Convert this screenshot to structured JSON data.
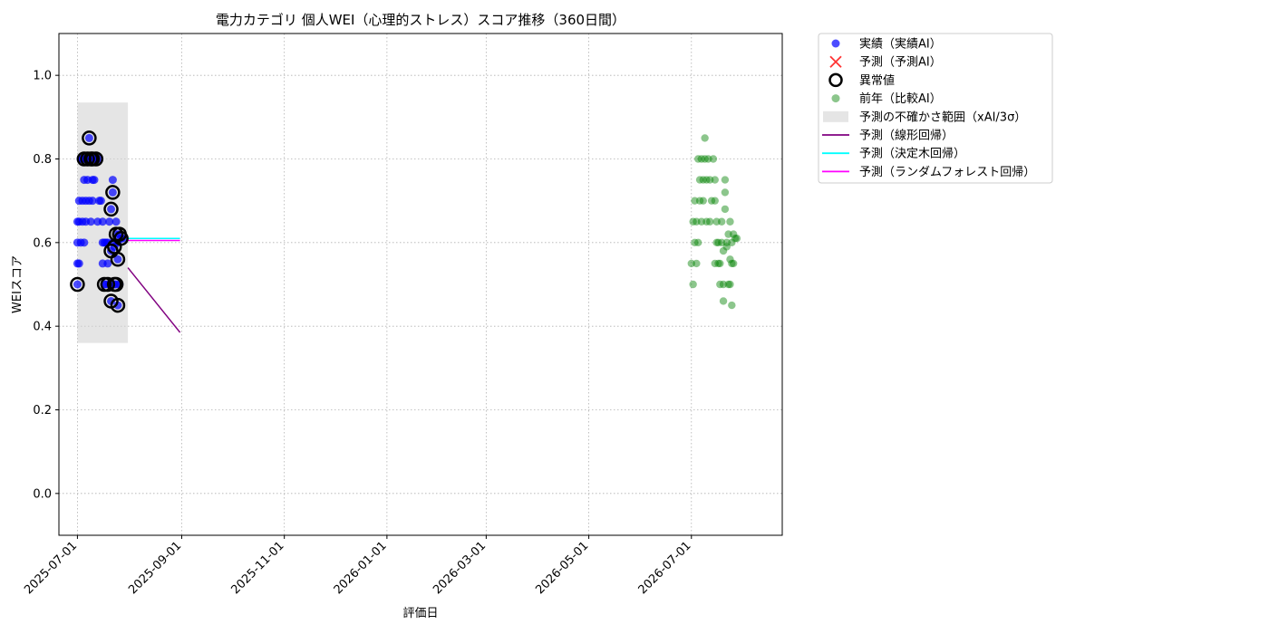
{
  "chart_data": {
    "type": "scatter",
    "title": "電力カテゴリ 個人WEI（心理的ストレス）スコア推移（360日間）",
    "xlabel": "評価日",
    "ylabel": "WEIスコア",
    "xlim": [
      "2025-06-20",
      "2026-08-24"
    ],
    "ylim": [
      -0.1,
      1.1
    ],
    "x_ticks": [
      "2025-07-01",
      "2025-09-01",
      "2025-11-01",
      "2026-01-01",
      "2026-03-01",
      "2026-05-01",
      "2026-07-01"
    ],
    "y_ticks": [
      0.0,
      0.2,
      0.4,
      0.6,
      0.8,
      1.0
    ],
    "y_tick_labels": [
      "0.0",
      "0.2",
      "0.4",
      "0.6",
      "0.8",
      "1.0"
    ],
    "grid": true,
    "legend_position": "outside-right-top",
    "colors": {
      "actual": "#0000ff",
      "predicted": "#ff0000",
      "anomaly": "#000000",
      "previous_year": "#008000",
      "uncertainty_band": "#d3d3d3",
      "linear": "#800080",
      "decision_tree": "#00ffff",
      "random_forest": "#ff00ff"
    },
    "series": [
      {
        "name": "実績（実績AI）",
        "kind": "scatter",
        "points": [
          [
            "2025-07-01",
            0.55
          ],
          [
            "2025-07-01",
            0.6
          ],
          [
            "2025-07-01",
            0.65
          ],
          [
            "2025-07-01",
            0.5
          ],
          [
            "2025-07-02",
            0.7
          ],
          [
            "2025-07-02",
            0.65
          ],
          [
            "2025-07-02",
            0.55
          ],
          [
            "2025-07-03",
            0.6
          ],
          [
            "2025-07-03",
            0.8
          ],
          [
            "2025-07-04",
            0.7
          ],
          [
            "2025-07-04",
            0.65
          ],
          [
            "2025-07-04",
            0.8
          ],
          [
            "2025-07-05",
            0.6
          ],
          [
            "2025-07-05",
            0.75
          ],
          [
            "2025-07-05",
            0.8
          ],
          [
            "2025-07-06",
            0.65
          ],
          [
            "2025-07-06",
            0.7
          ],
          [
            "2025-07-07",
            0.8
          ],
          [
            "2025-07-07",
            0.75
          ],
          [
            "2025-07-08",
            0.85
          ],
          [
            "2025-07-08",
            0.7
          ],
          [
            "2025-07-09",
            0.65
          ],
          [
            "2025-07-09",
            0.8
          ],
          [
            "2025-07-10",
            0.75
          ],
          [
            "2025-07-10",
            0.7
          ],
          [
            "2025-07-11",
            0.8
          ],
          [
            "2025-07-11",
            0.75
          ],
          [
            "2025-07-12",
            0.8
          ],
          [
            "2025-07-13",
            0.65
          ],
          [
            "2025-07-14",
            0.7
          ],
          [
            "2025-07-14",
            0.8
          ],
          [
            "2025-07-15",
            0.7
          ],
          [
            "2025-07-16",
            0.6
          ],
          [
            "2025-07-16",
            0.55
          ],
          [
            "2025-07-16",
            0.65
          ],
          [
            "2025-07-17",
            0.6
          ],
          [
            "2025-07-17",
            0.5
          ],
          [
            "2025-07-18",
            0.6
          ],
          [
            "2025-07-18",
            0.5
          ],
          [
            "2025-07-19",
            0.55
          ],
          [
            "2025-07-19",
            0.6
          ],
          [
            "2025-07-20",
            0.65
          ],
          [
            "2025-07-20",
            0.5
          ],
          [
            "2025-07-21",
            0.46
          ],
          [
            "2025-07-21",
            0.68
          ],
          [
            "2025-07-21",
            0.58
          ],
          [
            "2025-07-22",
            0.72
          ],
          [
            "2025-07-22",
            0.75
          ],
          [
            "2025-07-22",
            0.6
          ],
          [
            "2025-07-23",
            0.59
          ],
          [
            "2025-07-23",
            0.5
          ],
          [
            "2025-07-24",
            0.62
          ],
          [
            "2025-07-24",
            0.65
          ],
          [
            "2025-07-24",
            0.5
          ],
          [
            "2025-07-25",
            0.56
          ],
          [
            "2025-07-25",
            0.45
          ],
          [
            "2025-07-25",
            0.6
          ],
          [
            "2025-07-26",
            0.62
          ],
          [
            "2025-07-26",
            0.5
          ],
          [
            "2025-07-27",
            0.61
          ],
          [
            "2025-07-28",
            0.61
          ]
        ]
      },
      {
        "name": "異常値",
        "kind": "anomaly",
        "points": [
          [
            "2025-07-01",
            0.5
          ],
          [
            "2025-07-05",
            0.8
          ],
          [
            "2025-07-07",
            0.8
          ],
          [
            "2025-07-08",
            0.85
          ],
          [
            "2025-07-09",
            0.8
          ],
          [
            "2025-07-10",
            0.8
          ],
          [
            "2025-07-12",
            0.8
          ],
          [
            "2025-07-17",
            0.5
          ],
          [
            "2025-07-19",
            0.5
          ],
          [
            "2025-07-21",
            0.46
          ],
          [
            "2025-07-21",
            0.68
          ],
          [
            "2025-07-21",
            0.58
          ],
          [
            "2025-07-22",
            0.72
          ],
          [
            "2025-07-23",
            0.59
          ],
          [
            "2025-07-23",
            0.5
          ],
          [
            "2025-07-24",
            0.62
          ],
          [
            "2025-07-24",
            0.5
          ],
          [
            "2025-07-25",
            0.56
          ],
          [
            "2025-07-25",
            0.45
          ],
          [
            "2025-07-26",
            0.62
          ],
          [
            "2025-07-27",
            0.61
          ]
        ]
      },
      {
        "name": "前年（比較AI）",
        "kind": "scatter",
        "points": [
          [
            "2026-07-01",
            0.55
          ],
          [
            "2026-07-02",
            0.5
          ],
          [
            "2026-07-02",
            0.65
          ],
          [
            "2026-07-03",
            0.6
          ],
          [
            "2026-07-03",
            0.7
          ],
          [
            "2026-07-04",
            0.55
          ],
          [
            "2026-07-04",
            0.65
          ],
          [
            "2026-07-05",
            0.6
          ],
          [
            "2026-07-05",
            0.8
          ],
          [
            "2026-07-06",
            0.7
          ],
          [
            "2026-07-06",
            0.75
          ],
          [
            "2026-07-07",
            0.65
          ],
          [
            "2026-07-07",
            0.8
          ],
          [
            "2026-07-08",
            0.75
          ],
          [
            "2026-07-08",
            0.7
          ],
          [
            "2026-07-09",
            0.85
          ],
          [
            "2026-07-09",
            0.8
          ],
          [
            "2026-07-10",
            0.75
          ],
          [
            "2026-07-10",
            0.65
          ],
          [
            "2026-07-11",
            0.8
          ],
          [
            "2026-07-12",
            0.75
          ],
          [
            "2026-07-12",
            0.65
          ],
          [
            "2026-07-13",
            0.7
          ],
          [
            "2026-07-14",
            0.8
          ],
          [
            "2026-07-15",
            0.75
          ],
          [
            "2026-07-15",
            0.55
          ],
          [
            "2026-07-15",
            0.7
          ],
          [
            "2026-07-16",
            0.6
          ],
          [
            "2026-07-16",
            0.65
          ],
          [
            "2026-07-17",
            0.6
          ],
          [
            "2026-07-17",
            0.55
          ],
          [
            "2026-07-18",
            0.5
          ],
          [
            "2026-07-18",
            0.55
          ],
          [
            "2026-07-19",
            0.6
          ],
          [
            "2026-07-19",
            0.65
          ],
          [
            "2026-07-20",
            0.46
          ],
          [
            "2026-07-20",
            0.58
          ],
          [
            "2026-07-20",
            0.5
          ],
          [
            "2026-07-21",
            0.68
          ],
          [
            "2026-07-21",
            0.72
          ],
          [
            "2026-07-21",
            0.75
          ],
          [
            "2026-07-22",
            0.6
          ],
          [
            "2026-07-22",
            0.59
          ],
          [
            "2026-07-23",
            0.5
          ],
          [
            "2026-07-23",
            0.62
          ],
          [
            "2026-07-24",
            0.65
          ],
          [
            "2026-07-24",
            0.5
          ],
          [
            "2026-07-24",
            0.56
          ],
          [
            "2026-07-25",
            0.45
          ],
          [
            "2026-07-25",
            0.6
          ],
          [
            "2026-07-25",
            0.55
          ],
          [
            "2026-07-26",
            0.62
          ],
          [
            "2026-07-26",
            0.55
          ],
          [
            "2026-07-27",
            0.61
          ],
          [
            "2026-07-28",
            0.61
          ]
        ]
      },
      {
        "name": "予測の不確かさ範囲（xAI/3σ）",
        "kind": "band",
        "x": [
          "2025-07-01",
          "2025-07-31"
        ],
        "y": [
          0.36,
          0.935
        ]
      },
      {
        "name": "予測（線形回帰）",
        "kind": "line",
        "points": [
          [
            "2025-07-31",
            0.54
          ],
          [
            "2025-08-31",
            0.385
          ]
        ]
      },
      {
        "name": "予測（決定木回帰）",
        "kind": "line",
        "points": [
          [
            "2025-07-31",
            0.61
          ],
          [
            "2025-08-31",
            0.61
          ]
        ]
      },
      {
        "name": "予測（ランダムフォレスト回帰）",
        "kind": "line",
        "points": [
          [
            "2025-07-31",
            0.605
          ],
          [
            "2025-08-31",
            0.605
          ]
        ]
      }
    ],
    "legend": [
      {
        "label": "実績（実績AI）",
        "symbol": "dot",
        "color": "#0000ff"
      },
      {
        "label": "予測（予測AI）",
        "symbol": "cross",
        "color": "#ff0000"
      },
      {
        "label": "異常値",
        "symbol": "ring",
        "color": "#000000"
      },
      {
        "label": "前年（比較AI）",
        "symbol": "dot",
        "color": "#008000"
      },
      {
        "label": "予測の不確かさ範囲（xAI/3σ）",
        "symbol": "rect",
        "color": "#d3d3d3"
      },
      {
        "label": "予測（線形回帰）",
        "symbol": "line",
        "color": "#800080"
      },
      {
        "label": "予測（決定木回帰）",
        "symbol": "line",
        "color": "#00ffff"
      },
      {
        "label": "予測（ランダムフォレスト回帰）",
        "symbol": "line",
        "color": "#ff00ff"
      }
    ]
  }
}
